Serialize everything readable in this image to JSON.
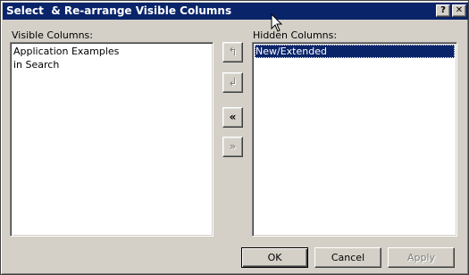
{
  "window": {
    "title": "Select  & Re-arrange Visible Columns",
    "help_label": "?",
    "close_label": "✕"
  },
  "visible_columns": {
    "label": "Visible Columns:",
    "items": [
      "Application Examples",
      "in Search"
    ]
  },
  "hidden_columns": {
    "label": "Hidden Columns:",
    "items": [
      "New/Extended"
    ],
    "selected_index": 0
  },
  "move_buttons": {
    "move_up_icon": "↰",
    "move_down_icon": "↲",
    "add_all_icon": "«",
    "remove_all_icon": "»"
  },
  "buttons": {
    "ok": "OK",
    "cancel": "Cancel",
    "apply": "Apply"
  }
}
